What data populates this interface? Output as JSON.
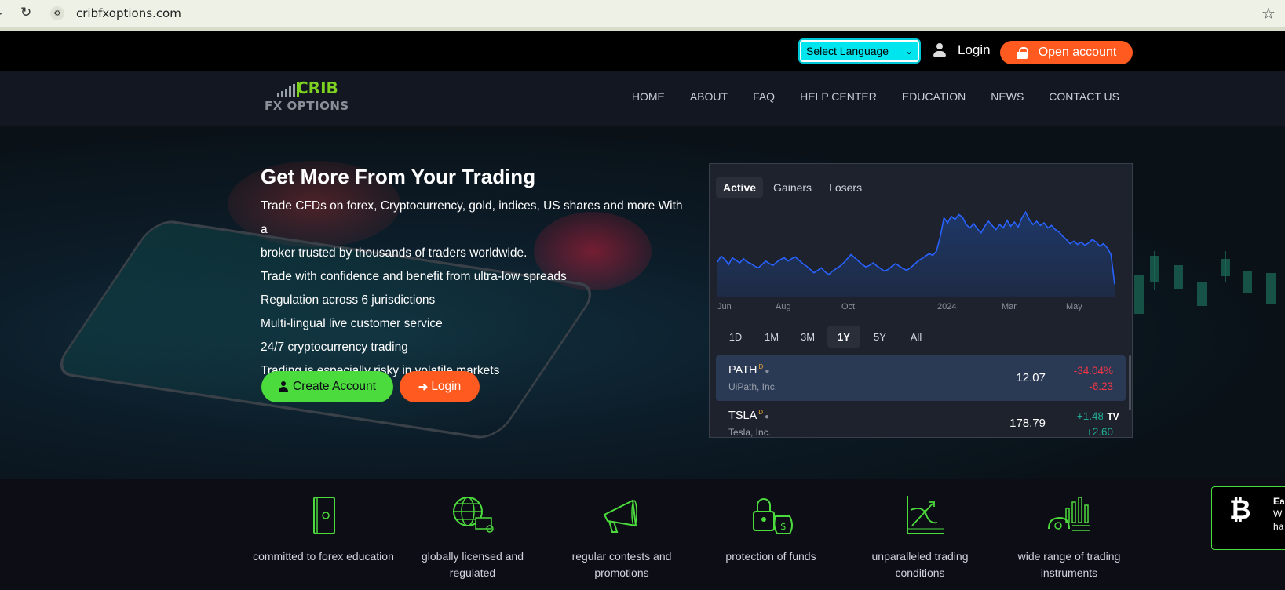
{
  "browser": {
    "url": "cribfxoptions.com"
  },
  "topbar": {
    "language_select": "Select Language",
    "login_label": "Login",
    "open_account_label": "Open account"
  },
  "logo": {
    "line1": "CRIB",
    "line2": "FX OPTIONS"
  },
  "nav": {
    "items": [
      "HOME",
      "ABOUT",
      "FAQ",
      "HELP CENTER",
      "EDUCATION",
      "NEWS",
      "CONTACT US"
    ]
  },
  "hero": {
    "title": "Get More From Your Trading",
    "lines": [
      "Trade CFDs on forex, Cryptocurrency, gold, indices, US shares and more With a",
      "broker trusted by thousands of traders worldwide.",
      "Trade with confidence and benefit from ultra-low spreads",
      "Regulation across 6 jurisdictions",
      "Multi-lingual live customer service",
      "24/7 cryptocurrency trading",
      "Trading is especially risky in volatile markets"
    ],
    "create_account_label": "Create Account",
    "login_label": "Login"
  },
  "widget": {
    "tabs": [
      "Active",
      "Gainers",
      "Losers"
    ],
    "active_tab": "Active",
    "ranges": [
      "1D",
      "1M",
      "3M",
      "1Y",
      "5Y",
      "All"
    ],
    "active_range": "1Y",
    "x_labels": [
      "Jun",
      "Aug",
      "Oct",
      "2024",
      "Mar",
      "May"
    ],
    "rows": [
      {
        "symbol": "PATH",
        "badge": "D",
        "name": "UiPath, Inc.",
        "price": "12.07",
        "change_pct": "-34.04%",
        "change_abs": "-6.23",
        "direction": "neg"
      },
      {
        "symbol": "TSLA",
        "badge": "D",
        "name": "Tesla, Inc.",
        "price": "178.79",
        "change_pct": "+1.48%",
        "change_abs": "+2.60",
        "direction": "pos"
      }
    ],
    "colors": {
      "line": "#2962ff",
      "positive": "#22ab94",
      "negative": "#f23645"
    },
    "tv_logo": "TV"
  },
  "chart_data": {
    "type": "area",
    "x_ticks": [
      "Jun",
      "Aug",
      "Oct",
      "2024",
      "Mar",
      "May"
    ],
    "values": [
      18.5,
      19.2,
      18.8,
      18.2,
      19.0,
      18.7,
      18.4,
      18.9,
      18.5,
      18.3,
      18.0,
      17.8,
      18.2,
      18.6,
      18.3,
      18.1,
      18.5,
      18.8,
      19.0,
      18.6,
      18.9,
      19.1,
      18.7,
      18.3,
      18.0,
      17.6,
      17.2,
      17.5,
      17.8,
      17.3,
      17.0,
      17.4,
      17.7,
      18.0,
      18.4,
      18.9,
      19.4,
      19.0,
      18.6,
      18.2,
      17.9,
      18.1,
      18.4,
      18.0,
      17.7,
      17.4,
      17.6,
      18.0,
      18.3,
      18.0,
      17.7,
      17.5,
      17.8,
      18.2,
      18.6,
      18.9,
      19.2,
      19.5,
      19.3,
      19.8,
      21.5,
      23.8,
      23.2,
      24.0,
      23.6,
      24.2,
      23.9,
      23.0,
      22.6,
      23.1,
      22.5,
      22.0,
      22.8,
      23.4,
      22.9,
      22.4,
      23.0,
      22.6,
      23.5,
      22.8,
      23.3,
      22.7,
      23.8,
      24.5,
      23.6,
      23.0,
      23.4,
      22.9,
      23.2,
      22.6,
      22.9,
      22.4,
      22.1,
      21.6,
      21.2,
      20.7,
      21.0,
      20.6,
      20.9,
      20.5,
      20.8,
      21.2,
      20.9,
      20.4,
      20.7,
      20.2,
      19.4,
      15.8
    ],
    "colors": {
      "line": "#2962ff",
      "fill": "#1e3a6e"
    }
  },
  "features": [
    {
      "icon": "book-icon",
      "label": "committed to forex education"
    },
    {
      "icon": "globe-certificate-icon",
      "label": "globally licensed and regulated"
    },
    {
      "icon": "megaphone-icon",
      "label": "regular contests and promotions"
    },
    {
      "icon": "lock-moneybag-icon",
      "label": "protection of funds"
    },
    {
      "icon": "chart-arrow-icon",
      "label": "unparalleled trading conditions"
    },
    {
      "icon": "instruments-icon",
      "label": "wide range of trading instruments"
    }
  ],
  "btc_popup": {
    "lines": [
      "Ea",
      "W",
      "ha"
    ]
  }
}
